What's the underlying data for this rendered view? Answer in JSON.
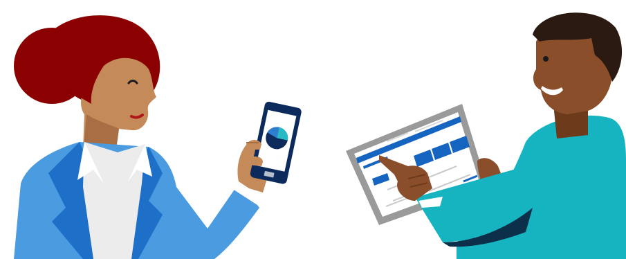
{
  "scene": {
    "background": "#ffffff",
    "woman": {
      "hair_color": "#8b0000",
      "skin_color": "#c48a5a",
      "skin_shadow_color": "#a86e44",
      "blazer_color": "#4a9be0",
      "blazer_shadow_color": "#1e6fc8",
      "shirt_color": "#ececec",
      "phone_color": "#0c2a5c",
      "phone_screen_color": "#ffffff",
      "phone_chart_colors": [
        "#0c2a5c",
        "#2f7fd0",
        "#27b9c4"
      ],
      "icons": [
        "smartphone-icon",
        "pie-chart-icon"
      ]
    },
    "man": {
      "hair_color": "#2b1a12",
      "skin_color": "#8a4f2a",
      "skin_shadow_color": "#6d3a1c",
      "shirt_color": "#15b4c0",
      "shirt_shadow_color": "#0c2f4a",
      "tablet_frame_color": "#9a9a9a",
      "tablet_screen_color": "#ffffff",
      "tablet_accent_color": "#1565c0",
      "icons": [
        "tablet-icon",
        "dashboard-icon"
      ]
    }
  }
}
